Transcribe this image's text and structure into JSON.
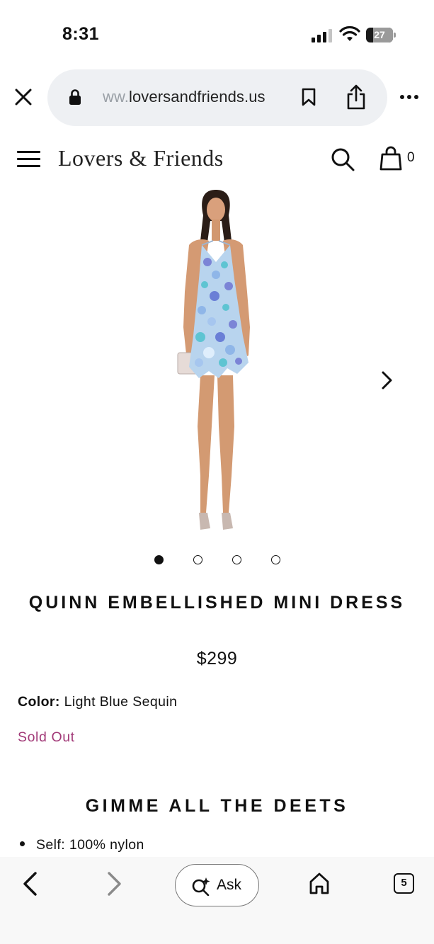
{
  "status_bar": {
    "time": "8:31",
    "battery_level": "27",
    "battery_fraction": 0.27
  },
  "browser": {
    "url_faded_prefix": "ww.",
    "url_domain": "loversandfriends.us",
    "icons": [
      "close-icon",
      "lock-icon",
      "bookmark-icon",
      "share-icon",
      "more-icon"
    ]
  },
  "site_header": {
    "logo": "Lovers & Friends",
    "cart_count": "0",
    "icons": [
      "menu-icon",
      "search-icon",
      "shopping-bag-icon"
    ]
  },
  "carousel": {
    "image_count": 4,
    "active_index": 0
  },
  "product": {
    "title": "QUINN EMBELLISHED MINI DRESS",
    "price": "$299",
    "color_label": "Color:",
    "color_value": "Light Blue Sequin",
    "availability": "Sold Out"
  },
  "details": {
    "heading": "GIMME ALL THE DEETS",
    "items": [
      "Self: 100% nylon"
    ]
  },
  "bottom_toolbar": {
    "ask_label": "Ask",
    "tab_count": "5",
    "icons": [
      "back-arrow-icon",
      "forward-arrow-icon",
      "ask-sparkle-icon",
      "home-icon",
      "tabs-icon"
    ]
  },
  "colors": {
    "accent_sold_out": "#a23a78",
    "url_pill_bg": "#eef0f3",
    "dress_light_blue": "#b8d4ee",
    "dress_sequin_purple": "#7b84d6",
    "dress_sequin_teal": "#5ec4d2"
  }
}
